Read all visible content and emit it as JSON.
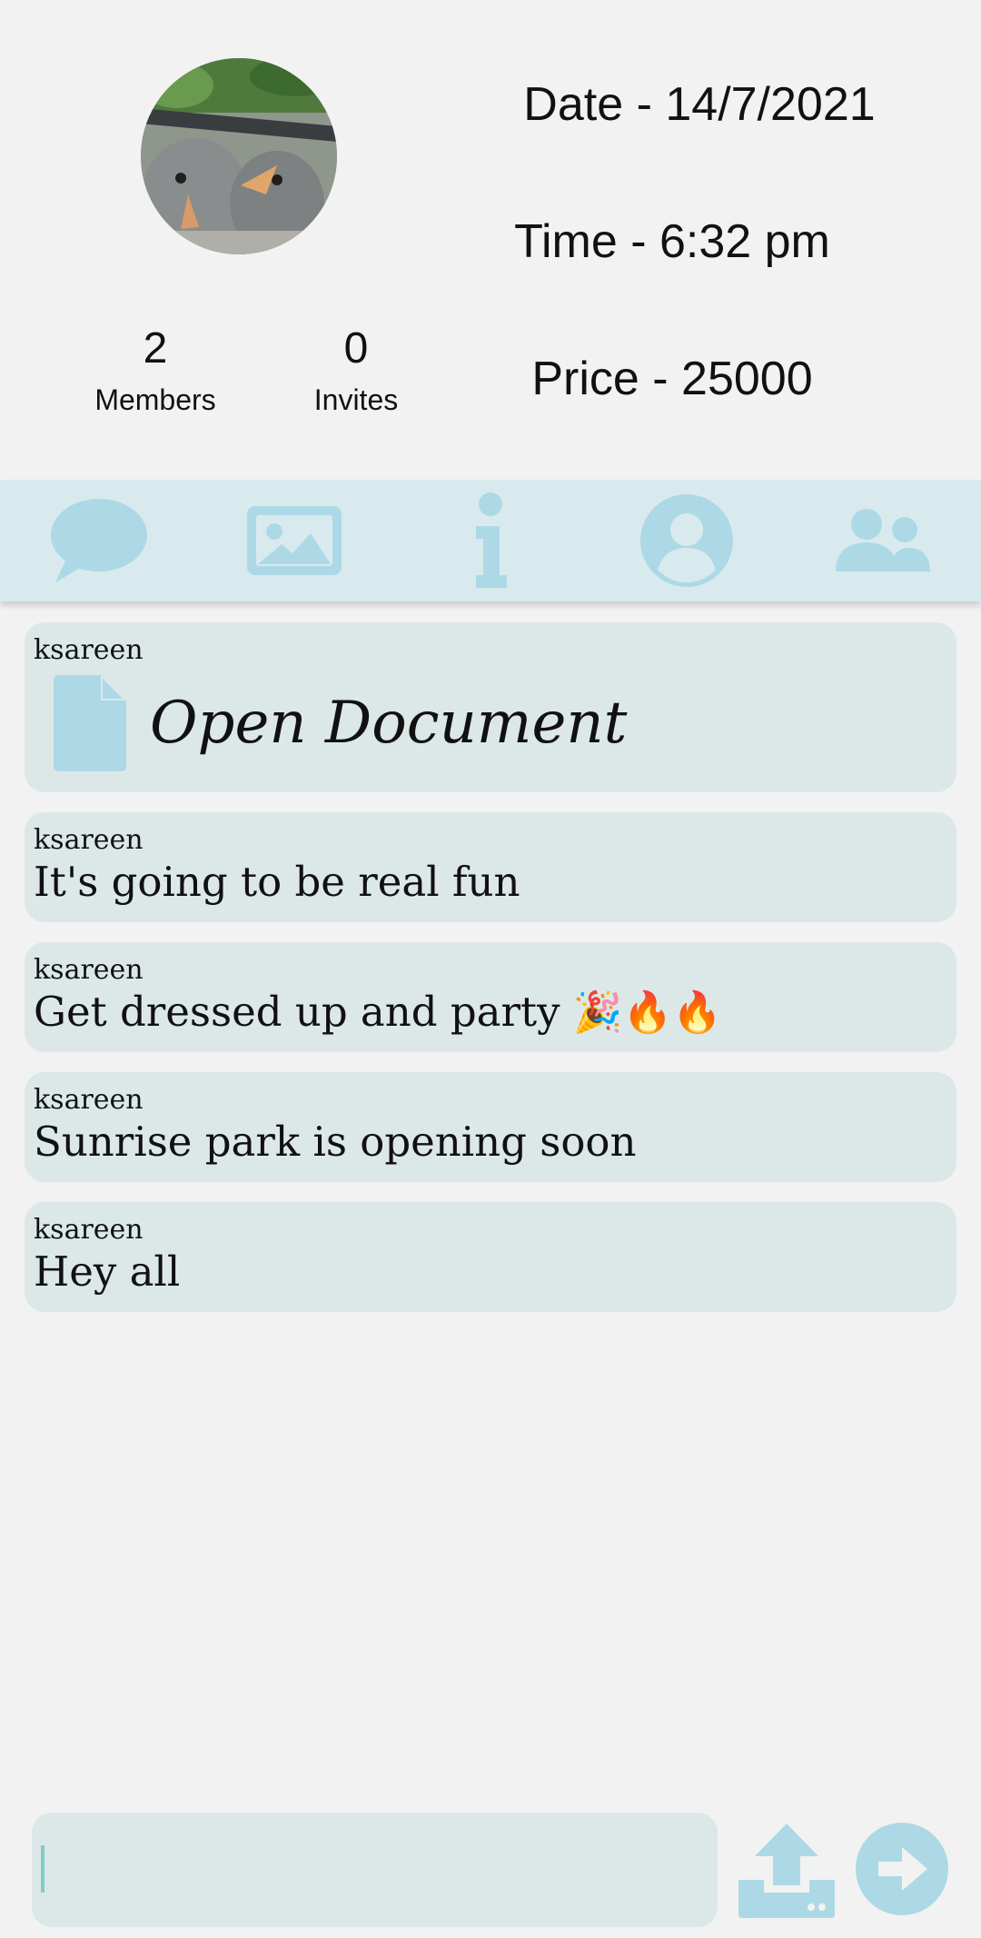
{
  "header": {
    "members": {
      "count": "2",
      "label": "Members"
    },
    "invites": {
      "count": "0",
      "label": "Invites"
    },
    "date": "Date - 14/7/2021",
    "time": "Time  - 6:32 pm",
    "price": "Price - 25000"
  },
  "tabs": [
    {
      "icon": "chat-bubble-icon"
    },
    {
      "icon": "image-icon"
    },
    {
      "icon": "info-icon"
    },
    {
      "icon": "user-profile-icon"
    },
    {
      "icon": "group-icon"
    }
  ],
  "messages": [
    {
      "sender": "ksareen",
      "type": "document",
      "text": "Open Document",
      "icon": "document-icon"
    },
    {
      "sender": "ksareen",
      "type": "text",
      "text": "It's going to be real fun"
    },
    {
      "sender": "ksareen",
      "type": "text",
      "text": "Get dressed up and party",
      "emojis": "🎉🔥🔥"
    },
    {
      "sender": "ksareen",
      "type": "text",
      "text": "Sunrise park is opening soon"
    },
    {
      "sender": "ksareen",
      "type": "text",
      "text": "Hey all"
    }
  ],
  "composer": {
    "value": "",
    "upload_icon": "upload-icon",
    "send_icon": "send-arrow-icon"
  },
  "colors": {
    "background": "#f2f2f2",
    "tabbar": "#d9eaee",
    "bubble": "#dce7e8",
    "icon": "#add8e6"
  }
}
